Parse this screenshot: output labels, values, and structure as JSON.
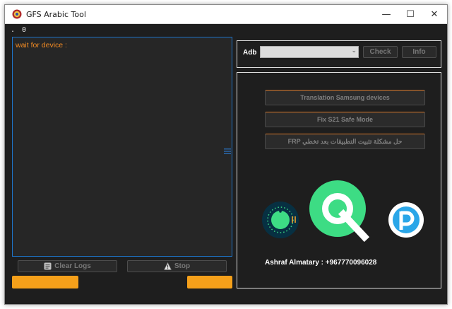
{
  "window": {
    "title": "GFS Arabic Tool",
    "controls": {
      "minimize": "—",
      "maximize": "☐",
      "close": "✕"
    }
  },
  "status": {
    "dot": ".",
    "count": "0"
  },
  "log": {
    "text": "wait for device :"
  },
  "bottom_buttons": {
    "clear_label": "Clear Logs",
    "stop_label": "Stop"
  },
  "adb": {
    "label": "Adb",
    "selected": "",
    "check_label": "Check",
    "info_label": "Info"
  },
  "tools": [
    {
      "label": "Translation Samsung devices"
    },
    {
      "label": "Fix S21 Safe Mode"
    },
    {
      "label": "حل مشكلة تثبيت التطبيقات بعد تخطي FRP"
    }
  ],
  "author": "Ashraf Almatary : +967770096028",
  "colors": {
    "accent_orange": "#f5a01a",
    "log_text": "#f08a24",
    "log_border": "#1e74c9",
    "background": "#1e1e1e"
  },
  "icons": [
    "app-icon",
    "clear-logs-icon",
    "stop-icon",
    "android-11-logo",
    "android-q-logo",
    "android-pie-logo"
  ]
}
